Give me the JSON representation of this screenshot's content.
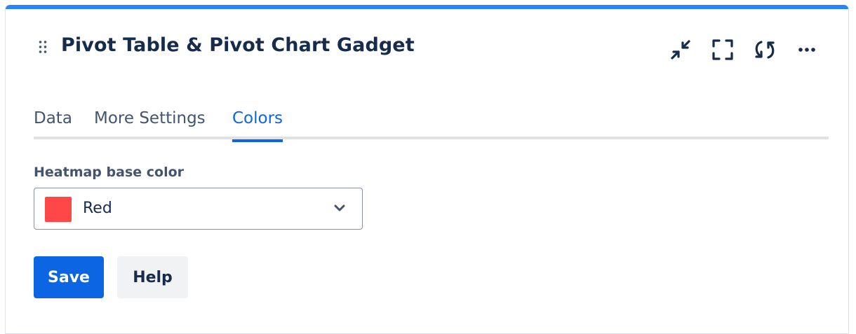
{
  "gadget": {
    "title": "Pivot Table & Pivot Chart Gadget",
    "accent_color": "#2684ff",
    "header_icons": [
      "drag-handle-icon",
      "minimize-icon",
      "fullscreen-icon",
      "refresh-icon",
      "more-icon"
    ]
  },
  "tabs": [
    {
      "label": "Data",
      "active": false
    },
    {
      "label": "More Settings",
      "active": false
    },
    {
      "label": "Colors",
      "active": true
    }
  ],
  "form": {
    "heatmap_label": "Heatmap base color",
    "heatmap_value": "Red",
    "heatmap_swatch_color": "#ff4747"
  },
  "buttons": {
    "save_label": "Save",
    "help_label": "Help"
  }
}
